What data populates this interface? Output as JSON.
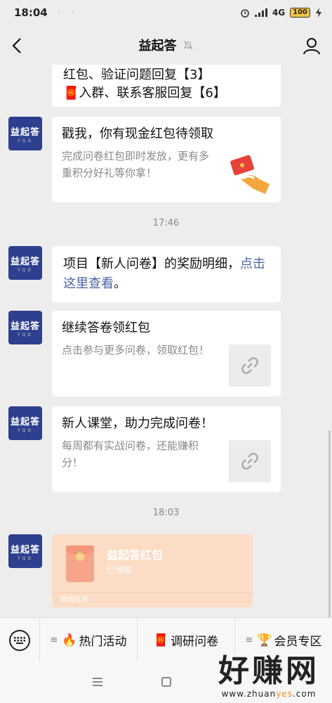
{
  "status_bar": {
    "time": "18:04",
    "indicators": "· ·",
    "network": "4G",
    "battery": "100"
  },
  "nav": {
    "title": "益起答",
    "back_icon": "chevron-left-icon",
    "mute_icon": "bell-off-icon",
    "profile_icon": "user-icon"
  },
  "avatar": {
    "name": "益起答",
    "sub": "YQD"
  },
  "messages": {
    "partial": {
      "line1": "红包、验证问题回复【3】",
      "line2": "入群、联系客服回复【6】",
      "emoji": "🧧"
    },
    "cash_card": {
      "title": "戳我，你有现金红包待领取",
      "desc": "完成问卷红包即时发放，更有多重积分好礼等你拿！"
    },
    "time1": "17:46",
    "reward_text": {
      "before": "项目【新人问卷】的奖励明细，",
      "link": "点击这里查看",
      "after": "。"
    },
    "card2": {
      "title": "继续答卷领红包",
      "desc": "点击参与更多问卷，领取红包！"
    },
    "card3": {
      "title": " 新人课堂，助力完成问卷！",
      "desc": "每周都有实战问卷，还能赚积分！"
    },
    "time2": "18:03",
    "red_packet": {
      "title": "益起答红包",
      "status": "已领取",
      "footer": "微信红包"
    }
  },
  "menu": {
    "keyboard_icon": "keyboard-icon",
    "items": [
      {
        "emoji": "🔥",
        "label": "热门活动"
      },
      {
        "emoji": "🧧",
        "label": "调研问卷"
      },
      {
        "emoji": "🏆",
        "label": "会员专区"
      }
    ]
  },
  "watermark": {
    "big": "好赚网",
    "url_prefix": "www.zhuan",
    "url_yes": "yes",
    "url_suffix": ".com"
  }
}
